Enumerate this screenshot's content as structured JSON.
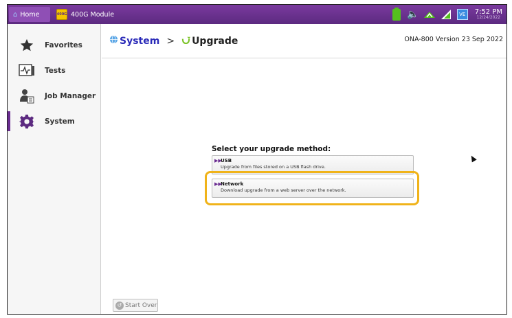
{
  "topbar": {
    "home_label": "Home",
    "module_label": "400G Module",
    "module_icon_text": "400G",
    "clock_time": "7:52 PM",
    "clock_date": "12/24/2022",
    "ve_label": "VE"
  },
  "sidebar": {
    "items": [
      {
        "label": "Favorites",
        "icon": "star-icon"
      },
      {
        "label": "Tests",
        "icon": "tests-icon"
      },
      {
        "label": "Job Manager",
        "icon": "job-manager-icon"
      },
      {
        "label": "System",
        "icon": "gear-icon",
        "active": true
      }
    ]
  },
  "header": {
    "crumb_system": "System",
    "crumb_sep": ">",
    "crumb_upgrade": "Upgrade",
    "version": "ONA-800 Version 23 Sep 2022"
  },
  "main": {
    "title": "Select your upgrade method:",
    "options": [
      {
        "title": "USB",
        "desc": "Upgrade from files stored on a USB flash drive."
      },
      {
        "title": "Network",
        "desc": "Download upgrade from a web server over the network."
      }
    ]
  },
  "footer": {
    "start_over_label": "Start Over"
  },
  "colors": {
    "accent": "#6a2c91",
    "highlight": "#f0b31a",
    "crumb_link": "#2a2ab8"
  }
}
